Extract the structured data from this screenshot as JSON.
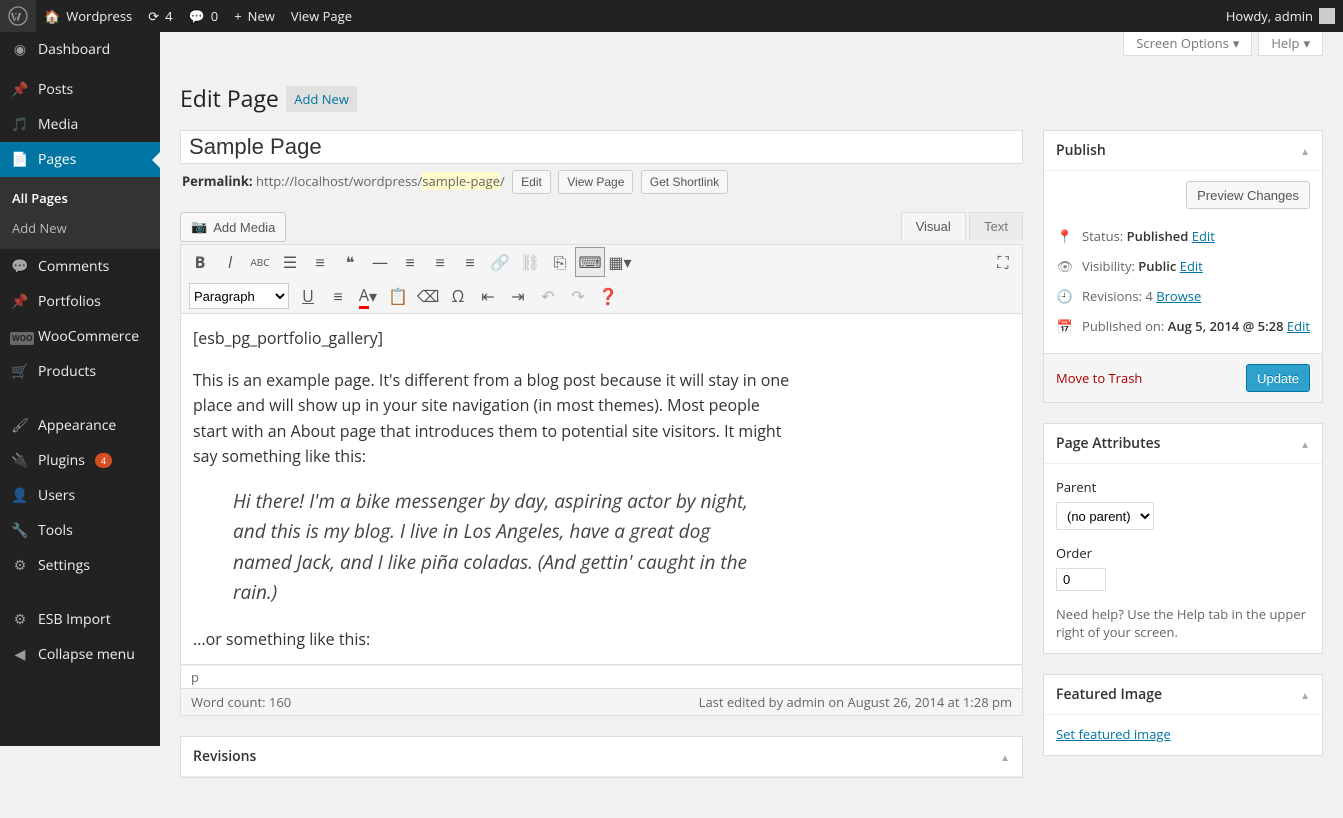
{
  "adminbar": {
    "site_name": "Wordpress",
    "updates_count": "4",
    "comments_count": "0",
    "new_label": "New",
    "view_page": "View Page",
    "howdy": "Howdy, admin"
  },
  "menu": {
    "dashboard": "Dashboard",
    "posts": "Posts",
    "media": "Media",
    "pages": "Pages",
    "pages_all": "All Pages",
    "pages_add": "Add New",
    "comments": "Comments",
    "portfolios": "Portfolios",
    "woo": "WooCommerce",
    "products": "Products",
    "appearance": "Appearance",
    "plugins": "Plugins",
    "plugins_badge": "4",
    "users": "Users",
    "tools": "Tools",
    "settings": "Settings",
    "esb_import": "ESB Import",
    "collapse": "Collapse menu"
  },
  "screen_meta": {
    "screen_options": "Screen Options",
    "help": "Help"
  },
  "heading": {
    "title": "Edit Page",
    "add_new": "Add New"
  },
  "title_field": {
    "value": "Sample Page"
  },
  "permalink": {
    "label": "Permalink:",
    "base": "http://localhost/wordpress/",
    "slug": "sample-page",
    "trail": "/",
    "edit": "Edit",
    "view": "View Page",
    "shortlink": "Get Shortlink"
  },
  "editor": {
    "add_media": "Add Media",
    "tab_visual": "Visual",
    "tab_text": "Text",
    "format_select": "Paragraph",
    "shortcode": "[esb_pg_portfolio_gallery]",
    "p1": "This is an example page. It's different from a blog post because it will stay in one place and will show up in your site navigation (in most themes). Most people start with an About page that introduces them to potential site visitors. It might say something like this:",
    "blockquote": "Hi there! I'm a bike messenger by day, aspiring actor by night, and this is my blog. I live in Los Angeles, have a great dog named Jack, and I like piña coladas. (And gettin' caught in the rain.)",
    "p2": "...or something like this:",
    "path": "p",
    "word_count_label": "Word count: ",
    "word_count": "160",
    "last_edit": "Last edited by admin on August 26, 2014 at 1:28 pm"
  },
  "publish": {
    "title": "Publish",
    "preview": "Preview Changes",
    "status_label": "Status:",
    "status_value": "Published",
    "visibility_label": "Visibility:",
    "visibility_value": "Public",
    "revisions_label": "Revisions:",
    "revisions_count": "4",
    "browse": "Browse",
    "published_on_label": "Published on:",
    "published_on_value": "Aug 5, 2014 @ 5:28",
    "edit": "Edit",
    "trash": "Move to Trash",
    "update": "Update"
  },
  "page_attributes": {
    "title": "Page Attributes",
    "parent_label": "Parent",
    "parent_value": "(no parent)",
    "order_label": "Order",
    "order_value": "0",
    "help": "Need help? Use the Help tab in the upper right of your screen."
  },
  "featured_image": {
    "title": "Featured Image",
    "set": "Set featured image"
  },
  "revisions_box": {
    "title": "Revisions"
  }
}
